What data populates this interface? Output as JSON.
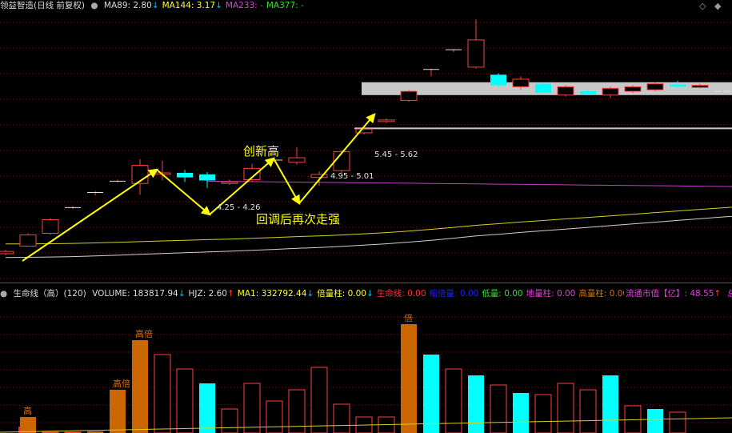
{
  "main_header": {
    "title": "领益智造(日线 前复权)",
    "items": [
      {
        "label": "MA89: 2.80",
        "arrow": "↓",
        "color": "#dcdcdc",
        "arrow_color": "#00c8ff"
      },
      {
        "label": "MA144: 3.17",
        "arrow": "↓",
        "color": "#ffff33",
        "arrow_color": "#00c8ff"
      },
      {
        "label": "MA233: -",
        "arrow": "",
        "color": "#e040e0",
        "arrow_color": "#00c8ff"
      },
      {
        "label": "MA377: -",
        "arrow": "",
        "color": "#33dd33",
        "arrow_color": "#00c8ff"
      }
    ],
    "window_icons": [
      "◇",
      "◆"
    ]
  },
  "sub_header": {
    "title": "生命线（高）(120)",
    "items": [
      {
        "label": "VOLUME: 183817.94",
        "arrow": "↓",
        "color": "#dcdcdc",
        "arrow_color": "#00c8ff"
      },
      {
        "label": "HJZ: 2.60",
        "arrow": "↑",
        "color": "#dcdcdc",
        "arrow_color": "#ff4040"
      },
      {
        "label": "MA1: 332792.44",
        "arrow": "↓",
        "color": "#ffff33",
        "arrow_color": "#00c8ff"
      },
      {
        "label": "倍量柱: 0.00",
        "arrow": "↓",
        "color": "#ffff33",
        "arrow_color": "#00c8ff"
      },
      {
        "label": "生命线: 0.00",
        "arrow": "",
        "color": "#ff3030",
        "arrow_color": "#00c8ff"
      },
      {
        "label": "缩倍量: 0.00",
        "arrow": "",
        "color": "#2020ff",
        "arrow_color": "#00c8ff"
      },
      {
        "label": "低量: 0.00",
        "arrow": "",
        "color": "#33dd33",
        "arrow_color": "#00c8ff"
      },
      {
        "label": "地量柱: 0.00",
        "arrow": "",
        "color": "#e040e0",
        "arrow_color": "#00c8ff"
      },
      {
        "label": "高量柱: 0.00",
        "arrow": "",
        "color": "#d07010",
        "arrow_color": "#00c8ff"
      }
    ],
    "right_label": "流通市值【亿】: 48.55",
    "right_arrow": "↑",
    "right_tail": "总市"
  },
  "annotations": {
    "new_high": "创新高",
    "pullback": "回调后再次走强",
    "range_low": "4.25 - 4.26",
    "range_mid": "4.95 - 5.01",
    "range_high": "5.45 - 5.62"
  },
  "bar_markers": {
    "double": "倍",
    "high": "高"
  },
  "colors": {
    "up": "#ff4040",
    "down": "#00ffff",
    "orange": "#cc6600",
    "arrow": "#ffff00",
    "ma_white": "#d0d0d0",
    "ma_yellow": "#d8d020",
    "ma_purple": "#c040c0",
    "grid": "#7a1010"
  },
  "chart_data": {
    "type": "candlestick",
    "price_axis_labels": [],
    "candles": [
      {
        "o": 3.35,
        "c": 3.38,
        "h": 3.4,
        "l": 3.33
      },
      {
        "o": 3.45,
        "c": 3.6,
        "h": 3.62,
        "l": 3.44
      },
      {
        "o": 3.62,
        "c": 3.8,
        "h": 3.82,
        "l": 3.6
      },
      {
        "o": 3.95,
        "c": 3.96,
        "h": 3.98,
        "l": 3.94
      },
      {
        "o": 4.15,
        "c": 4.16,
        "h": 4.18,
        "l": 4.12
      },
      {
        "o": 4.3,
        "c": 4.31,
        "h": 4.33,
        "l": 4.29
      },
      {
        "o": 4.28,
        "c": 4.52,
        "h": 4.6,
        "l": 4.13
      },
      {
        "o": 4.4,
        "c": 4.42,
        "h": 4.58,
        "l": 4.32
      },
      {
        "o": 4.42,
        "c": 4.36,
        "h": 4.46,
        "l": 4.3
      },
      {
        "o": 4.4,
        "c": 4.32,
        "h": 4.43,
        "l": 4.22
      },
      {
        "o": 4.28,
        "c": 4.3,
        "h": 4.33,
        "l": 4.26
      },
      {
        "o": 4.33,
        "c": 4.48,
        "h": 4.54,
        "l": 4.31
      },
      {
        "o": 4.58,
        "c": 4.59,
        "h": 4.62,
        "l": 4.56
      },
      {
        "o": 4.56,
        "c": 4.62,
        "h": 4.76,
        "l": 4.53
      },
      {
        "o": 4.36,
        "c": 4.4,
        "h": 4.44,
        "l": 4.25
      },
      {
        "o": 4.45,
        "c": 4.7,
        "h": 4.72,
        "l": 4.42
      },
      {
        "o": 4.95,
        "c": 5.0,
        "h": 5.05,
        "l": 4.93
      },
      {
        "o": 5.1,
        "c": 5.12,
        "h": 5.14,
        "l": 5.08
      },
      {
        "o": 5.38,
        "c": 5.5,
        "h": 5.52,
        "l": 5.36
      },
      {
        "o": 5.78,
        "c": 5.79,
        "h": 5.8,
        "l": 5.7
      },
      {
        "o": 6.04,
        "c": 6.05,
        "h": 6.06,
        "l": 6.02
      },
      {
        "o": 5.82,
        "c": 6.18,
        "h": 6.45,
        "l": 5.8
      },
      {
        "o": 5.72,
        "c": 5.58,
        "h": 5.74,
        "l": 5.56
      },
      {
        "o": 5.56,
        "c": 5.66,
        "h": 5.7,
        "l": 5.52
      },
      {
        "o": 5.6,
        "c": 5.48,
        "h": 5.62,
        "l": 5.47
      },
      {
        "o": 5.45,
        "c": 5.56,
        "h": 5.58,
        "l": 5.43
      },
      {
        "o": 5.5,
        "c": 5.46,
        "h": 5.52,
        "l": 5.45
      },
      {
        "o": 5.45,
        "c": 5.54,
        "h": 5.56,
        "l": 5.41
      },
      {
        "o": 5.5,
        "c": 5.56,
        "h": 5.58,
        "l": 5.48
      },
      {
        "o": 5.52,
        "c": 5.6,
        "h": 5.62,
        "l": 5.5
      },
      {
        "o": 5.59,
        "c": 5.56,
        "h": 5.64,
        "l": 5.55
      },
      {
        "o": 5.55,
        "c": 5.58,
        "h": 5.6,
        "l": 5.54
      },
      {
        "o": 5.5,
        "c": 5.5,
        "h": 5.51,
        "l": 5.49
      },
      {
        "o": 5.47,
        "c": 5.49,
        "h": 5.51,
        "l": 5.46
      }
    ],
    "volume": [
      {
        "v": 3,
        "t": "r",
        "m": "倍"
      },
      {
        "v": 10,
        "t": "o",
        "m": "高"
      },
      {
        "v": 0.5,
        "t": "r",
        "m": ""
      },
      {
        "v": 0.5,
        "t": "r",
        "m": ""
      },
      {
        "v": 1,
        "t": "o",
        "m": ""
      },
      {
        "v": 27,
        "t": "o",
        "m": "高倍"
      },
      {
        "v": 58,
        "t": "o",
        "m": "高倍"
      },
      {
        "v": 49,
        "t": "r",
        "m": ""
      },
      {
        "v": 40,
        "t": "r",
        "m": ""
      },
      {
        "v": 31,
        "t": "c",
        "m": ""
      },
      {
        "v": 15,
        "t": "r",
        "m": ""
      },
      {
        "v": 31,
        "t": "r",
        "m": ""
      },
      {
        "v": 20,
        "t": "r",
        "m": ""
      },
      {
        "v": 27,
        "t": "r",
        "m": ""
      },
      {
        "v": 41,
        "t": "r",
        "m": ""
      },
      {
        "v": 18,
        "t": "r",
        "m": ""
      },
      {
        "v": 10,
        "t": "r",
        "m": ""
      },
      {
        "v": 10,
        "t": "r",
        "m": ""
      },
      {
        "v": 68,
        "t": "o",
        "m": "倍"
      },
      {
        "v": 49,
        "t": "c",
        "m": ""
      },
      {
        "v": 40,
        "t": "r",
        "m": ""
      },
      {
        "v": 36,
        "t": "c",
        "m": ""
      },
      {
        "v": 30,
        "t": "r",
        "m": ""
      },
      {
        "v": 25,
        "t": "c",
        "m": ""
      },
      {
        "v": 24,
        "t": "r",
        "m": ""
      },
      {
        "v": 31,
        "t": "r",
        "m": ""
      },
      {
        "v": 27,
        "t": "r",
        "m": ""
      },
      {
        "v": 36,
        "t": "c",
        "m": ""
      },
      {
        "v": 17,
        "t": "r",
        "m": ""
      },
      {
        "v": 15,
        "t": "c",
        "m": ""
      },
      {
        "v": 13,
        "t": "r",
        "m": ""
      }
    ]
  }
}
